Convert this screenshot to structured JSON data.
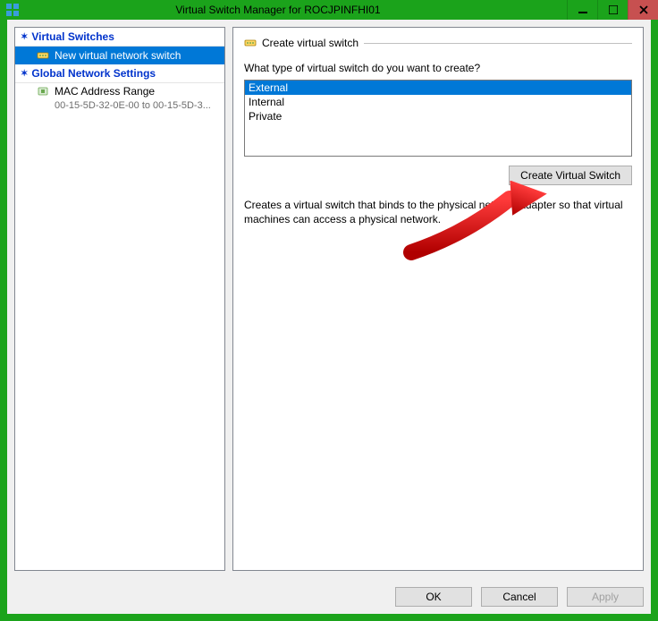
{
  "titlebar": {
    "title": "Virtual Switch Manager for ROCJPINFHI01"
  },
  "tree": {
    "section1": "Virtual Switches",
    "item1": "New virtual network switch",
    "section2": "Global Network Settings",
    "item2": "MAC Address Range",
    "item2detail": "00-15-5D-32-0E-00 to 00-15-5D-3..."
  },
  "main": {
    "section_title": "Create virtual switch",
    "prompt": "What type of virtual switch do you want to create?",
    "options": [
      "External",
      "Internal",
      "Private"
    ],
    "create_btn": "Create Virtual Switch",
    "description": "Creates a virtual switch that binds to the physical network adapter so that virtual machines can access a physical network."
  },
  "buttons": {
    "ok": "OK",
    "cancel": "Cancel",
    "apply": "Apply"
  }
}
